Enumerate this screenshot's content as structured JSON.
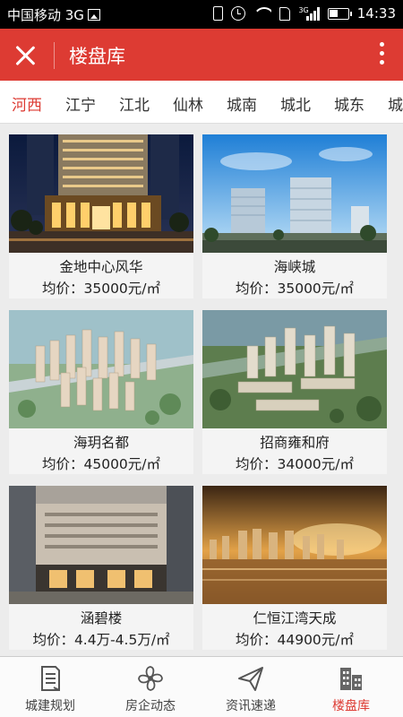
{
  "status_bar": {
    "carrier": "中国移动 3G",
    "network_label": "3G",
    "time": "14:33"
  },
  "toolbar": {
    "title": "楼盘库"
  },
  "tabs": [
    {
      "label": "河西",
      "active": true
    },
    {
      "label": "江宁",
      "active": false
    },
    {
      "label": "江北",
      "active": false
    },
    {
      "label": "仙林",
      "active": false
    },
    {
      "label": "城南",
      "active": false
    },
    {
      "label": "城北",
      "active": false
    },
    {
      "label": "城东",
      "active": false
    },
    {
      "label": "城",
      "active": false
    }
  ],
  "listings": [
    {
      "name": "金地中心风华",
      "price": "均价：35000元/㎡"
    },
    {
      "name": "海峡城",
      "price": "均价：35000元/㎡"
    },
    {
      "name": "海玥名都",
      "price": "均价：45000元/㎡"
    },
    {
      "name": "招商雍和府",
      "price": "均价：34000元/㎡"
    },
    {
      "name": "涵碧楼",
      "price": "均价：4.4万-4.5万/㎡"
    },
    {
      "name": "仁恒江湾天成",
      "price": "均价：44900元/㎡"
    }
  ],
  "bottom_nav": [
    {
      "label": "城建规划",
      "icon": "document-icon",
      "active": false
    },
    {
      "label": "房企动态",
      "icon": "fan-icon",
      "active": false
    },
    {
      "label": "资讯速递",
      "icon": "paper-plane-icon",
      "active": false
    },
    {
      "label": "楼盘库",
      "icon": "buildings-icon",
      "active": true
    }
  ],
  "colors": {
    "accent": "#dd3b33",
    "status_bar": "#000000"
  }
}
